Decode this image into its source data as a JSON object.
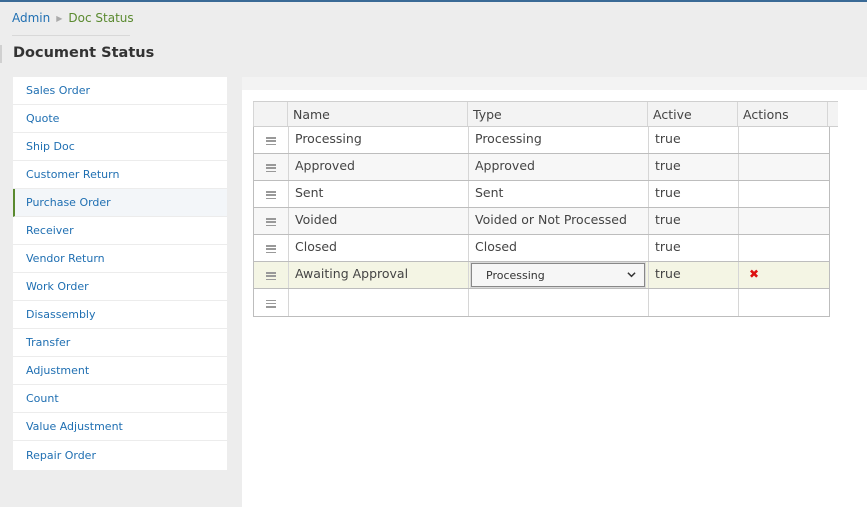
{
  "breadcrumb": {
    "root": "Admin",
    "current": "Doc Status"
  },
  "page_title": "Document Status",
  "sidebar": {
    "items": [
      {
        "label": "Sales Order",
        "active": false
      },
      {
        "label": "Quote",
        "active": false
      },
      {
        "label": "Ship Doc",
        "active": false
      },
      {
        "label": "Customer Return",
        "active": false
      },
      {
        "label": "Purchase Order",
        "active": true
      },
      {
        "label": "Receiver",
        "active": false
      },
      {
        "label": "Vendor Return",
        "active": false
      },
      {
        "label": "Work Order",
        "active": false
      },
      {
        "label": "Disassembly",
        "active": false
      },
      {
        "label": "Transfer",
        "active": false
      },
      {
        "label": "Adjustment",
        "active": false
      },
      {
        "label": "Count",
        "active": false
      },
      {
        "label": "Value Adjustment",
        "active": false
      },
      {
        "label": "Repair Order",
        "active": false
      }
    ]
  },
  "grid": {
    "columns": [
      "Name",
      "Type",
      "Active",
      "Actions"
    ],
    "rows": [
      {
        "name": "Processing",
        "type": "Processing",
        "active": "true"
      },
      {
        "name": "Approved",
        "type": "Approved",
        "active": "true"
      },
      {
        "name": "Sent",
        "type": "Sent",
        "active": "true"
      },
      {
        "name": "Voided",
        "type": "Voided or Not Processed",
        "active": "true"
      },
      {
        "name": "Closed",
        "type": "Closed",
        "active": "true"
      }
    ],
    "editing_row": {
      "name": "Awaiting Approval",
      "type_selected": "Processing",
      "active": "true",
      "delete_icon": "x-delete-icon"
    }
  },
  "colors": {
    "link": "#1f6fb2",
    "current_crumb": "#5a8a2f",
    "delete": "#dd1111",
    "editing_row_bg": "#f4f5e4"
  }
}
